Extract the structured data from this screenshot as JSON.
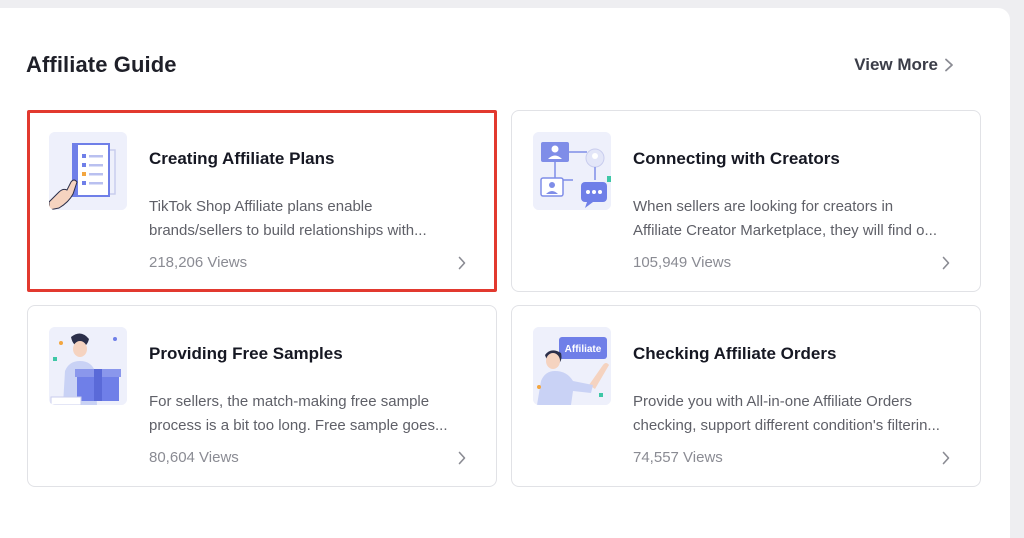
{
  "section": {
    "title": "Affiliate Guide",
    "view_more": "View More"
  },
  "cards": [
    {
      "title": "Creating Affiliate Plans",
      "desc_line1": "TikTok Shop Affiliate plans enable",
      "desc_line2": "brands/sellers to build relationships with...",
      "views": "218,206 Views",
      "icon": "affiliate-plan-document-icon"
    },
    {
      "title": "Connecting with Creators",
      "desc_line1": "When sellers are looking for creators in",
      "desc_line2": "Affiliate Creator Marketplace, they will find o...",
      "views": "105,949 Views",
      "icon": "creator-network-chat-icon"
    },
    {
      "title": "Providing Free Samples",
      "desc_line1": "For sellers, the match-making free sample",
      "desc_line2": "process is a bit too long. Free sample goes...",
      "views": "80,604 Views",
      "icon": "person-with-sample-box-icon"
    },
    {
      "title": "Checking Affiliate Orders",
      "desc_line1": "Provide you with All-in-one Affiliate Orders",
      "desc_line2": "checking, support different condition's filterin...",
      "views": "74,557 Views",
      "badge": "Affiliate",
      "icon": "person-with-affiliate-badge-icon"
    }
  ],
  "colors": {
    "selected_outline": "#e2392f",
    "accent_blue": "#6f7fe8"
  }
}
